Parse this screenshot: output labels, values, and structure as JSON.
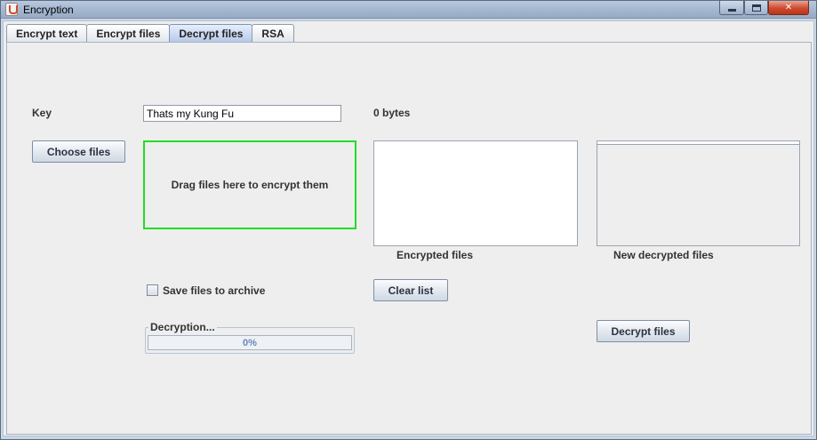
{
  "window": {
    "title": "Encryption",
    "icon": "java-cup-icon"
  },
  "tabs": [
    {
      "label": "Encrypt text",
      "active": false
    },
    {
      "label": "Encrypt files",
      "active": false
    },
    {
      "label": "Decrypt files",
      "active": true
    },
    {
      "label": "RSA",
      "active": false
    }
  ],
  "panel": {
    "key_label": "Key",
    "key_value": "Thats my Kung Fu",
    "size_label": "0 bytes",
    "choose_files_label": "Choose files",
    "dropzone_text": "Drag files here to encrypt them",
    "encrypted_files_label": "Encrypted files",
    "new_decrypted_files_label": "New decrypted files",
    "save_archive_label": "Save files to archive",
    "save_archive_checked": false,
    "clear_list_label": "Clear list",
    "progress_title": "Decryption...",
    "progress_text": "0%",
    "progress_value": 0,
    "decrypt_files_label": "Decrypt files"
  },
  "colors": {
    "dropzone_border": "#22dd22",
    "active_tab": "#b6c9e9",
    "progress_text": "#6b86b6"
  }
}
